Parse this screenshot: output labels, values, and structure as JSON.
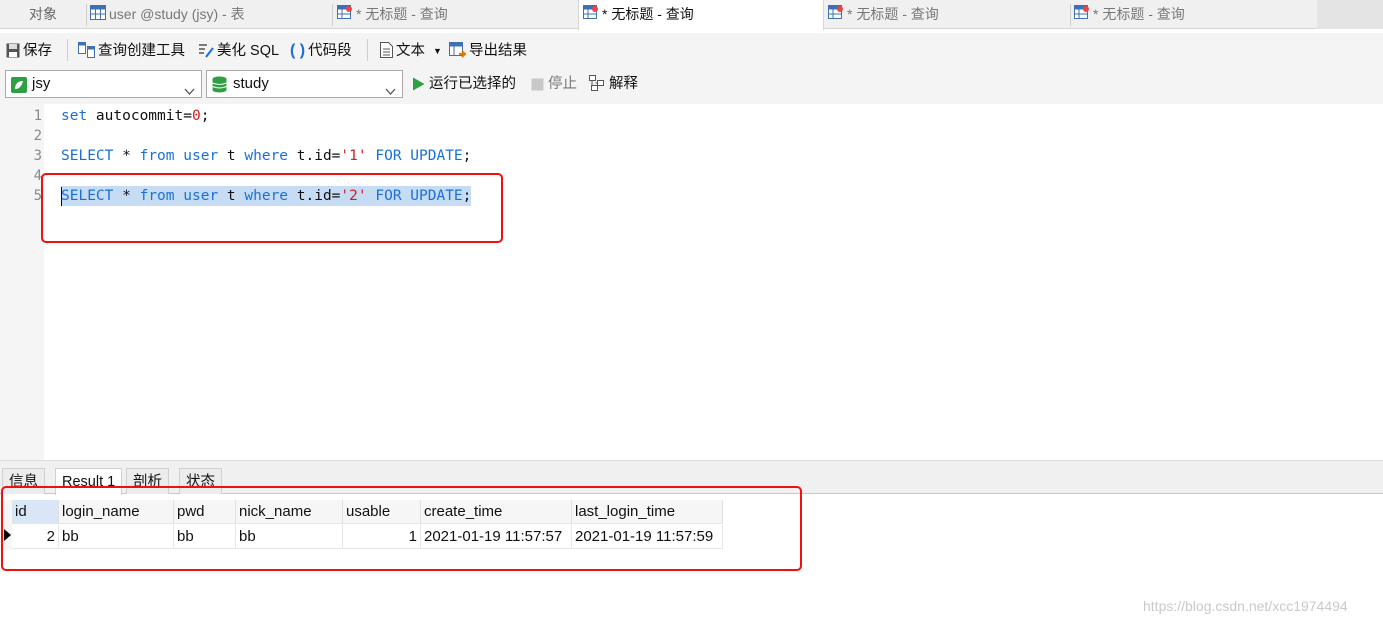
{
  "tabs": {
    "objects": "对象",
    "items": [
      {
        "label": "user @study (jsy) - 表",
        "icon": "table-icon"
      },
      {
        "label": "* 无标题 - 查询",
        "icon": "query-icon"
      },
      {
        "label": "* 无标题 - 查询",
        "icon": "query-icon",
        "active": true
      },
      {
        "label": "* 无标题 - 查询",
        "icon": "query-icon"
      },
      {
        "label": "* 无标题 - 查询",
        "icon": "query-icon"
      }
    ]
  },
  "toolbar": {
    "save": "保存",
    "query_builder": "查询创建工具",
    "beautify_sql": "美化 SQL",
    "code_snippet": "代码段",
    "text": "文本",
    "export_result": "导出结果"
  },
  "toolbar2": {
    "connection": "jsy",
    "database": "study",
    "run_selected": "运行已选择的",
    "stop": "停止",
    "explain": "解释"
  },
  "editor": {
    "line_numbers": [
      "1",
      "2",
      "3",
      "4",
      "5"
    ],
    "lines": {
      "l1": {
        "kw": "set",
        "rest": " autocommit=",
        "num": "0",
        "end": ";"
      },
      "l3": {
        "kw1": "SELECT",
        "p1": " * ",
        "kw2": "from",
        "p2": " ",
        "kw3": "user",
        "p3": " t ",
        "kw4": "where",
        "p4": " t.id=",
        "str": "'1'",
        "p5": " ",
        "kw5": "FOR UPDATE",
        "end": ";"
      },
      "l5": {
        "kw1": "SELECT",
        "p1": " * ",
        "kw2": "from",
        "p2": " ",
        "kw3": "user",
        "p3": " t ",
        "kw4": "where",
        "p4": " t.id=",
        "str": "'2'",
        "p5": " ",
        "kw5": "FOR UPDATE",
        "end": ";"
      }
    }
  },
  "result_tabs": [
    "信息",
    "Result 1",
    "剖析",
    "状态"
  ],
  "result_grid": {
    "columns": [
      "id",
      "login_name",
      "pwd",
      "nick_name",
      "usable",
      "create_time",
      "last_login_time"
    ],
    "rows": [
      [
        "2",
        "bb",
        "bb",
        "bb",
        "1",
        "2021-01-19 11:57:57",
        "2021-01-19 11:57:59"
      ]
    ]
  },
  "watermark": "https://blog.csdn.net/xcc1974494",
  "colors": {
    "highlight_box": "#f01010",
    "keyword": "#1a6fd6",
    "string": "#d21b1b",
    "selection": "#c6dcf4"
  }
}
